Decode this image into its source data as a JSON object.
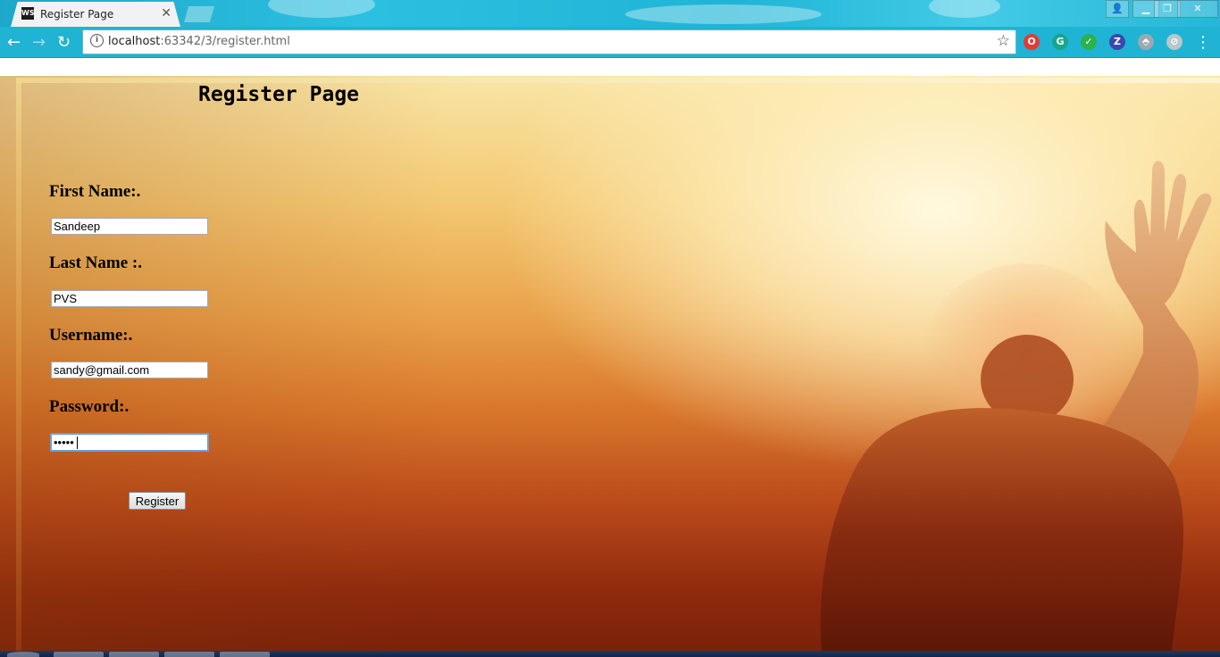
{
  "browser": {
    "tab_title": "Register Page",
    "tab_favicon_text": "WS",
    "url_host": "localhost",
    "url_rest": ":63342/3/register.html",
    "window_controls": {
      "minimize": "▁",
      "restore": "❐",
      "close": "✕"
    },
    "extensions": [
      {
        "name": "opera-extension-icon",
        "glyph": "O",
        "color": "#e53935"
      },
      {
        "name": "grammarly-extension-icon",
        "glyph": "G",
        "color": "#17a68a"
      },
      {
        "name": "check-extension-icon",
        "glyph": "✓",
        "color": "#2bb24c"
      },
      {
        "name": "zotero-extension-icon",
        "glyph": "Z",
        "color": "#3949ab"
      },
      {
        "name": "shield-extension-icon",
        "glyph": "⬘",
        "color": "#9aa9b0"
      },
      {
        "name": "compass-extension-icon",
        "glyph": "⊘",
        "color": "#b7c7cc"
      }
    ]
  },
  "page": {
    "title": "Register Page",
    "fields": [
      {
        "label": "First Name:.",
        "value": "Sandeep"
      },
      {
        "label": "Last Name :.",
        "value": "PVS"
      },
      {
        "label": "Username:.",
        "value": "sandy@gmail.com"
      },
      {
        "label": "Password:.",
        "value": "•••••"
      }
    ],
    "register_label": "Register"
  }
}
